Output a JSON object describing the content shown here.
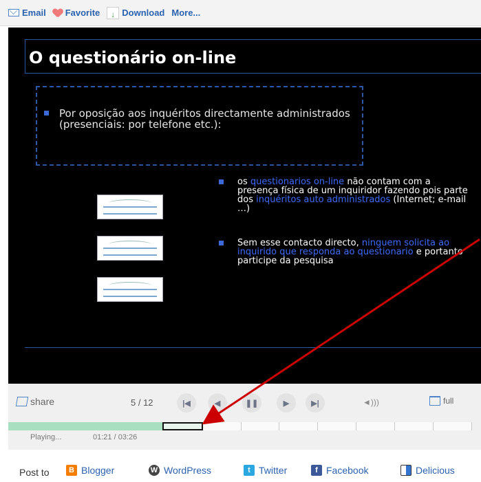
{
  "toolbar": {
    "email": "Email",
    "favorite": "Favorite",
    "download": "Download",
    "more": "More..."
  },
  "slide": {
    "title": "O questionário on-line",
    "bullet_main": "Por oposição aos inquéritos directamente administrados (presenciais: por telefone etc.):",
    "b1": {
      "pre": "os",
      "hl1": "questionarios on-line",
      "mid": "não contam com a presença física de um inquiridor fazendo pois parte dos",
      "hl2": "inquéritos auto administrados",
      "post": "(Internet; e-mail …)"
    },
    "b2": {
      "pre": "Sem esse contacto directo,",
      "hl1": "ninguem solicita ao inquirido que responda ao questionario",
      "post": "e portanto participe da pesquisa"
    }
  },
  "player": {
    "share": "share",
    "counter": "5 / 12",
    "full": "full",
    "status": "Playing...",
    "time": "01:21 / 03:26",
    "current_segment": 5,
    "total_segments": 12
  },
  "bottom": {
    "post_to": "Post to",
    "services": [
      "Blogger",
      "WordPress",
      "Twitter",
      "Facebook",
      "Delicious"
    ]
  },
  "colors": {
    "accent": "#2b62b0",
    "slide_bg": "#000000",
    "highlight": "#3e6bff",
    "progress_fill": "#a8dfc0",
    "arrow": "#cc0000"
  }
}
